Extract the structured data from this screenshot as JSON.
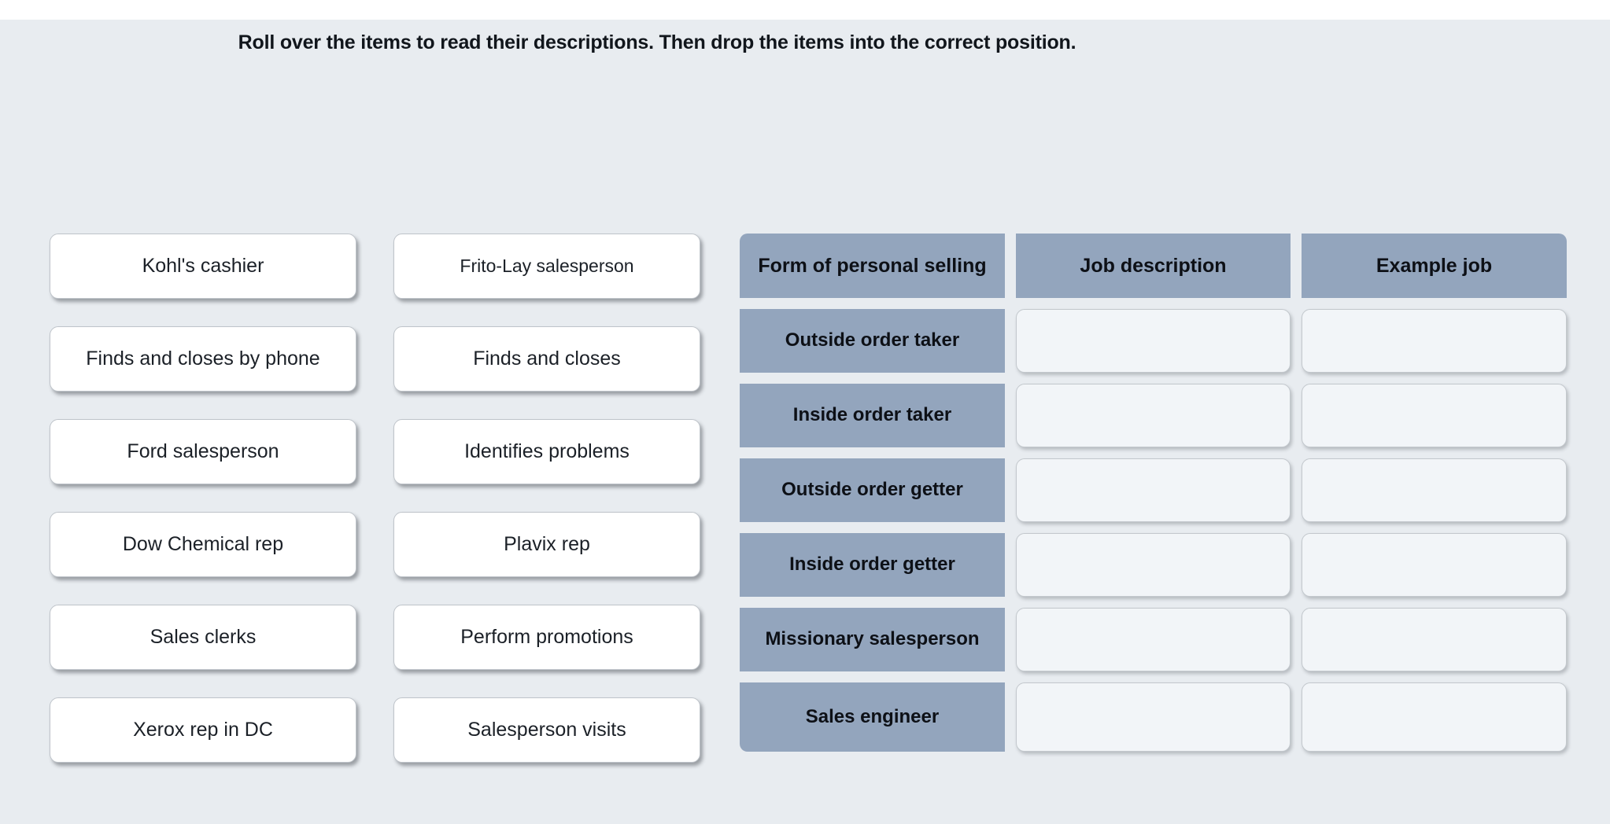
{
  "instruction": "Roll over the items to read their descriptions. Then drop the items into the correct position.",
  "drag_items": {
    "column_1": [
      {
        "label": "Kohl's cashier"
      },
      {
        "label": "Finds and closes by phone"
      },
      {
        "label": "Ford salesperson"
      },
      {
        "label": "Dow Chemical rep"
      },
      {
        "label": "Sales clerks"
      },
      {
        "label": "Xerox rep in DC"
      }
    ],
    "column_2": [
      {
        "label": "Frito-Lay salesperson"
      },
      {
        "label": "Finds and closes"
      },
      {
        "label": "Identifies problems"
      },
      {
        "label": "Plavix rep"
      },
      {
        "label": "Perform promotions"
      },
      {
        "label": "Salesperson visits"
      }
    ]
  },
  "table": {
    "headers": [
      {
        "label": "Form of personal selling"
      },
      {
        "label": "Job description"
      },
      {
        "label": "Example job"
      }
    ],
    "rows": [
      {
        "label": "Outside order taker",
        "job_description": "",
        "example_job": ""
      },
      {
        "label": "Inside order taker",
        "job_description": "",
        "example_job": ""
      },
      {
        "label": "Outside order getter",
        "job_description": "",
        "example_job": ""
      },
      {
        "label": "Inside order getter",
        "job_description": "",
        "example_job": ""
      },
      {
        "label": "Missionary salesperson",
        "job_description": "",
        "example_job": ""
      },
      {
        "label": "Sales engineer",
        "job_description": "",
        "example_job": ""
      }
    ]
  },
  "colors": {
    "stage_background": "#e8ecf0",
    "header_cell": "#93a5bd",
    "row_label_cell": "#93a5bd",
    "drop_cell": "#f2f5f8",
    "drag_item": "#ffffff",
    "text": "#1b2027"
  }
}
